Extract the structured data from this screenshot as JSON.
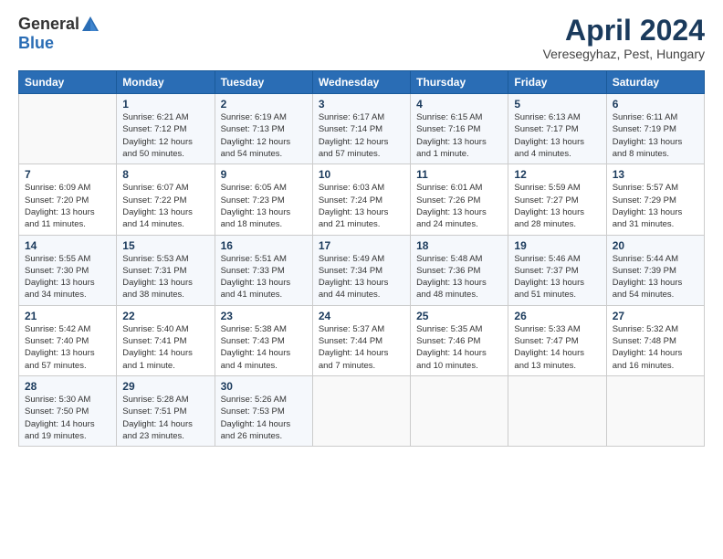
{
  "header": {
    "logo_line1": "General",
    "logo_line2": "Blue",
    "title": "April 2024",
    "location": "Veresegyhaz, Pest, Hungary"
  },
  "weekdays": [
    "Sunday",
    "Monday",
    "Tuesday",
    "Wednesday",
    "Thursday",
    "Friday",
    "Saturday"
  ],
  "weeks": [
    [
      {
        "day": "",
        "info": ""
      },
      {
        "day": "1",
        "info": "Sunrise: 6:21 AM\nSunset: 7:12 PM\nDaylight: 12 hours\nand 50 minutes."
      },
      {
        "day": "2",
        "info": "Sunrise: 6:19 AM\nSunset: 7:13 PM\nDaylight: 12 hours\nand 54 minutes."
      },
      {
        "day": "3",
        "info": "Sunrise: 6:17 AM\nSunset: 7:14 PM\nDaylight: 12 hours\nand 57 minutes."
      },
      {
        "day": "4",
        "info": "Sunrise: 6:15 AM\nSunset: 7:16 PM\nDaylight: 13 hours\nand 1 minute."
      },
      {
        "day": "5",
        "info": "Sunrise: 6:13 AM\nSunset: 7:17 PM\nDaylight: 13 hours\nand 4 minutes."
      },
      {
        "day": "6",
        "info": "Sunrise: 6:11 AM\nSunset: 7:19 PM\nDaylight: 13 hours\nand 8 minutes."
      }
    ],
    [
      {
        "day": "7",
        "info": "Sunrise: 6:09 AM\nSunset: 7:20 PM\nDaylight: 13 hours\nand 11 minutes."
      },
      {
        "day": "8",
        "info": "Sunrise: 6:07 AM\nSunset: 7:22 PM\nDaylight: 13 hours\nand 14 minutes."
      },
      {
        "day": "9",
        "info": "Sunrise: 6:05 AM\nSunset: 7:23 PM\nDaylight: 13 hours\nand 18 minutes."
      },
      {
        "day": "10",
        "info": "Sunrise: 6:03 AM\nSunset: 7:24 PM\nDaylight: 13 hours\nand 21 minutes."
      },
      {
        "day": "11",
        "info": "Sunrise: 6:01 AM\nSunset: 7:26 PM\nDaylight: 13 hours\nand 24 minutes."
      },
      {
        "day": "12",
        "info": "Sunrise: 5:59 AM\nSunset: 7:27 PM\nDaylight: 13 hours\nand 28 minutes."
      },
      {
        "day": "13",
        "info": "Sunrise: 5:57 AM\nSunset: 7:29 PM\nDaylight: 13 hours\nand 31 minutes."
      }
    ],
    [
      {
        "day": "14",
        "info": "Sunrise: 5:55 AM\nSunset: 7:30 PM\nDaylight: 13 hours\nand 34 minutes."
      },
      {
        "day": "15",
        "info": "Sunrise: 5:53 AM\nSunset: 7:31 PM\nDaylight: 13 hours\nand 38 minutes."
      },
      {
        "day": "16",
        "info": "Sunrise: 5:51 AM\nSunset: 7:33 PM\nDaylight: 13 hours\nand 41 minutes."
      },
      {
        "day": "17",
        "info": "Sunrise: 5:49 AM\nSunset: 7:34 PM\nDaylight: 13 hours\nand 44 minutes."
      },
      {
        "day": "18",
        "info": "Sunrise: 5:48 AM\nSunset: 7:36 PM\nDaylight: 13 hours\nand 48 minutes."
      },
      {
        "day": "19",
        "info": "Sunrise: 5:46 AM\nSunset: 7:37 PM\nDaylight: 13 hours\nand 51 minutes."
      },
      {
        "day": "20",
        "info": "Sunrise: 5:44 AM\nSunset: 7:39 PM\nDaylight: 13 hours\nand 54 minutes."
      }
    ],
    [
      {
        "day": "21",
        "info": "Sunrise: 5:42 AM\nSunset: 7:40 PM\nDaylight: 13 hours\nand 57 minutes."
      },
      {
        "day": "22",
        "info": "Sunrise: 5:40 AM\nSunset: 7:41 PM\nDaylight: 14 hours\nand 1 minute."
      },
      {
        "day": "23",
        "info": "Sunrise: 5:38 AM\nSunset: 7:43 PM\nDaylight: 14 hours\nand 4 minutes."
      },
      {
        "day": "24",
        "info": "Sunrise: 5:37 AM\nSunset: 7:44 PM\nDaylight: 14 hours\nand 7 minutes."
      },
      {
        "day": "25",
        "info": "Sunrise: 5:35 AM\nSunset: 7:46 PM\nDaylight: 14 hours\nand 10 minutes."
      },
      {
        "day": "26",
        "info": "Sunrise: 5:33 AM\nSunset: 7:47 PM\nDaylight: 14 hours\nand 13 minutes."
      },
      {
        "day": "27",
        "info": "Sunrise: 5:32 AM\nSunset: 7:48 PM\nDaylight: 14 hours\nand 16 minutes."
      }
    ],
    [
      {
        "day": "28",
        "info": "Sunrise: 5:30 AM\nSunset: 7:50 PM\nDaylight: 14 hours\nand 19 minutes."
      },
      {
        "day": "29",
        "info": "Sunrise: 5:28 AM\nSunset: 7:51 PM\nDaylight: 14 hours\nand 23 minutes."
      },
      {
        "day": "30",
        "info": "Sunrise: 5:26 AM\nSunset: 7:53 PM\nDaylight: 14 hours\nand 26 minutes."
      },
      {
        "day": "",
        "info": ""
      },
      {
        "day": "",
        "info": ""
      },
      {
        "day": "",
        "info": ""
      },
      {
        "day": "",
        "info": ""
      }
    ]
  ]
}
